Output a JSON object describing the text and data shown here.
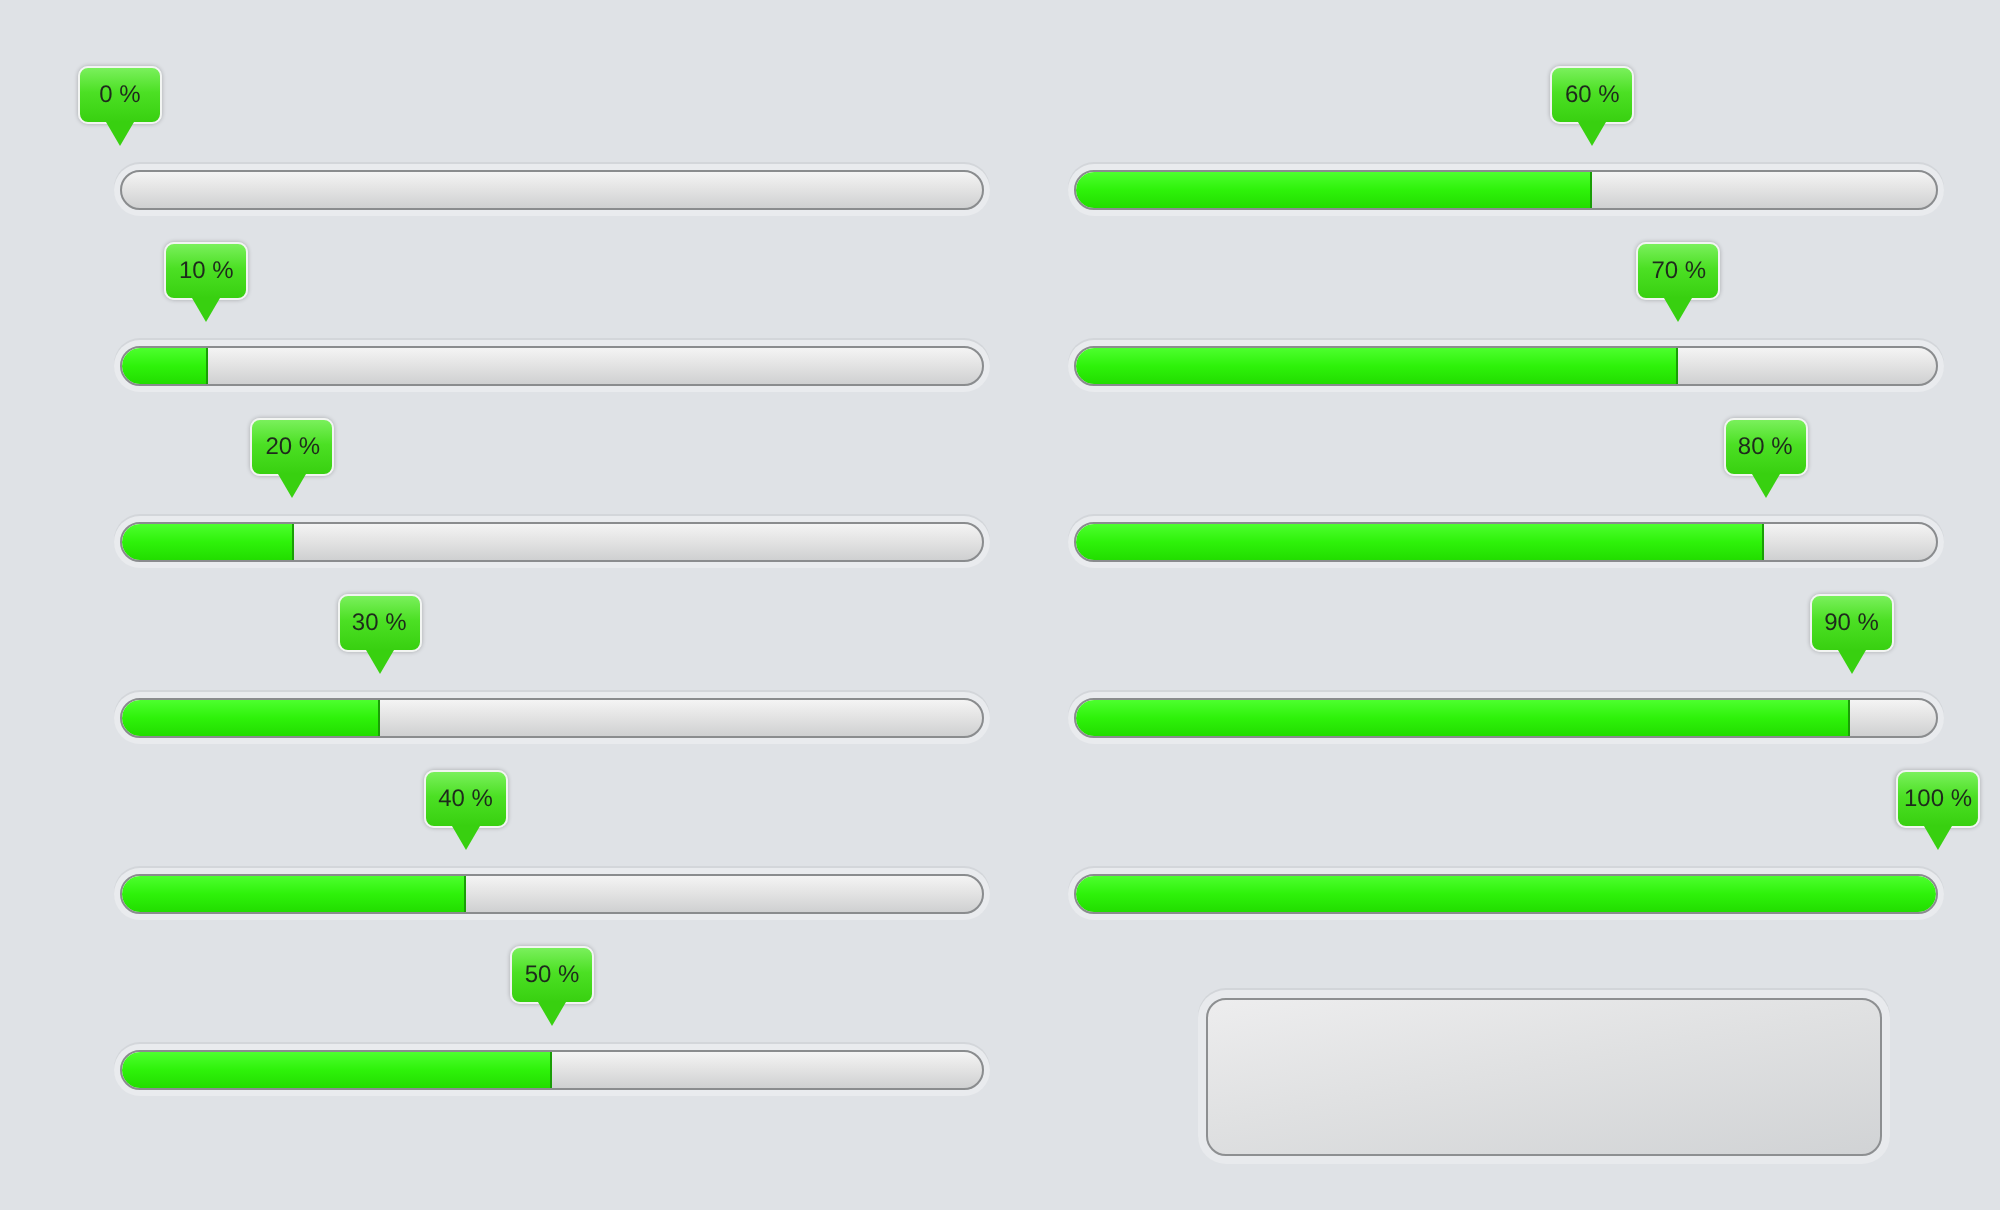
{
  "columns": [
    {
      "progress_bars": [
        {
          "label": "0 %",
          "level": 0
        },
        {
          "label": "10 %",
          "level": 0.1
        },
        {
          "label": "20 %",
          "level": 0.2
        },
        {
          "label": "30 %",
          "level": 0.3
        },
        {
          "label": "40 %",
          "level": 0.4
        },
        {
          "label": "50 %",
          "level": 0.5
        }
      ]
    },
    {
      "progress_bars": [
        {
          "label": "60 %",
          "level": 0.6
        },
        {
          "label": "70 %",
          "level": 0.7
        },
        {
          "label": "80 %",
          "level": 0.8
        },
        {
          "label": "90 %",
          "level": 0.9
        },
        {
          "label": "100 %",
          "level": 1
        }
      ],
      "blank_button": true
    }
  ]
}
